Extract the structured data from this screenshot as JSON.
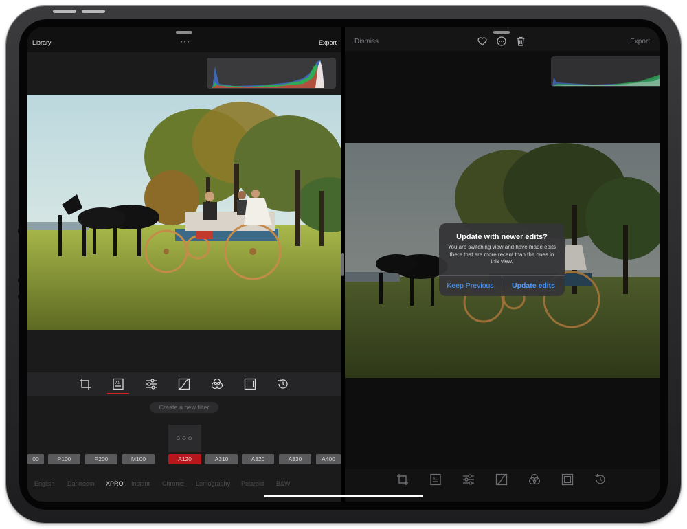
{
  "left_pane": {
    "library_label": "Library",
    "more_label": "···",
    "export_label": "Export",
    "new_filter_placeholder": "Create a new filter",
    "selected_filter_thumb": "○○○",
    "filters": [
      "00",
      "P100",
      "P200",
      "M100",
      "A120",
      "A310",
      "A320",
      "A330",
      "A400"
    ],
    "selected_filter": "A120",
    "categories": [
      "English",
      "Darkroom",
      "XPRO",
      "Instant",
      "Chrome",
      "Lomography",
      "Polaroid",
      "B&W"
    ],
    "active_category": "XPRO",
    "tools": [
      "crop-icon",
      "filter-icon",
      "adjust-icon",
      "curves-icon",
      "color-icon",
      "frame-icon",
      "history-icon"
    ],
    "active_tool": "filter-icon"
  },
  "right_pane": {
    "dismiss_label": "Dismiss",
    "export_label": "Export",
    "header_icons": [
      "heart-icon",
      "more-circle-icon",
      "trash-icon"
    ],
    "tools": [
      "crop-icon",
      "filter-icon",
      "adjust-icon",
      "curves-icon",
      "color-icon",
      "frame-icon",
      "history-icon"
    ]
  },
  "alert": {
    "title": "Update with newer edits?",
    "message": "You are switching view and have made edits there that are more recent than the ones in this view.",
    "keep_label": "Keep Previous",
    "update_label": "Update edits"
  },
  "colors": {
    "accent_red": "#d9222a",
    "alert_button_blue": "#4a9bff"
  }
}
